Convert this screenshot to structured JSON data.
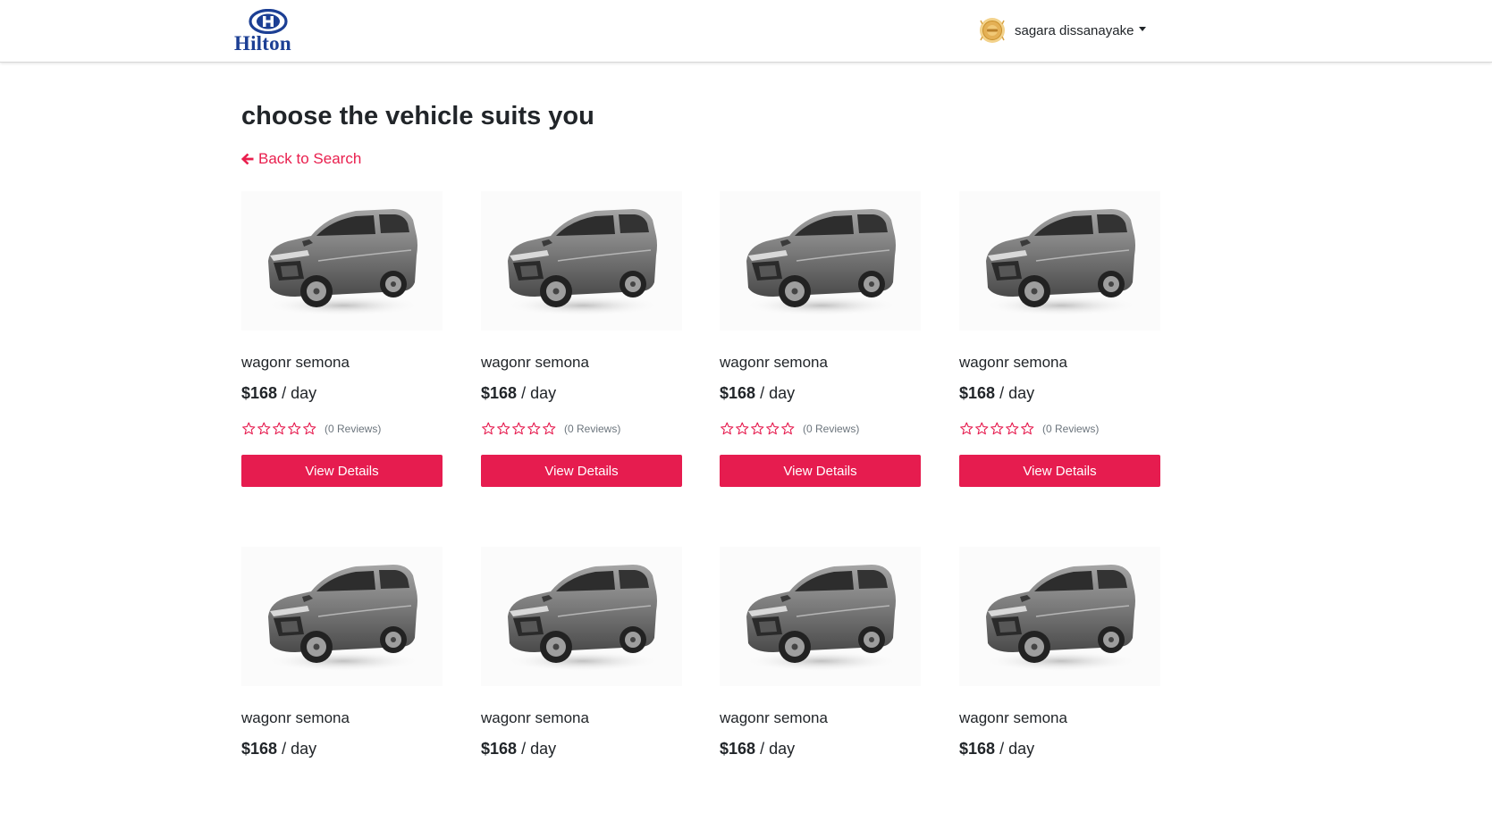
{
  "brand": {
    "name": "Hilton",
    "logo_letter": "H"
  },
  "user": {
    "name": "sagara dissanayake"
  },
  "page": {
    "title": "choose the vehicle suits you",
    "back_label": "Back to Search"
  },
  "colors": {
    "accent": "#e61c4f",
    "brand": "#1c3f94"
  },
  "vehicles": [
    {
      "name": "wagonr semona",
      "price": "$168",
      "unit": "/ day",
      "rating": 0,
      "reviews": "(0 Reviews)",
      "button": "View Details"
    },
    {
      "name": "wagonr semona",
      "price": "$168",
      "unit": "/ day",
      "rating": 0,
      "reviews": "(0 Reviews)",
      "button": "View Details"
    },
    {
      "name": "wagonr semona",
      "price": "$168",
      "unit": "/ day",
      "rating": 0,
      "reviews": "(0 Reviews)",
      "button": "View Details"
    },
    {
      "name": "wagonr semona",
      "price": "$168",
      "unit": "/ day",
      "rating": 0,
      "reviews": "(0 Reviews)",
      "button": "View Details"
    },
    {
      "name": "wagonr semona",
      "price": "$168",
      "unit": "/ day"
    },
    {
      "name": "wagonr semona",
      "price": "$168",
      "unit": "/ day"
    },
    {
      "name": "wagonr semona",
      "price": "$168",
      "unit": "/ day"
    },
    {
      "name": "wagonr semona",
      "price": "$168",
      "unit": "/ day"
    }
  ]
}
